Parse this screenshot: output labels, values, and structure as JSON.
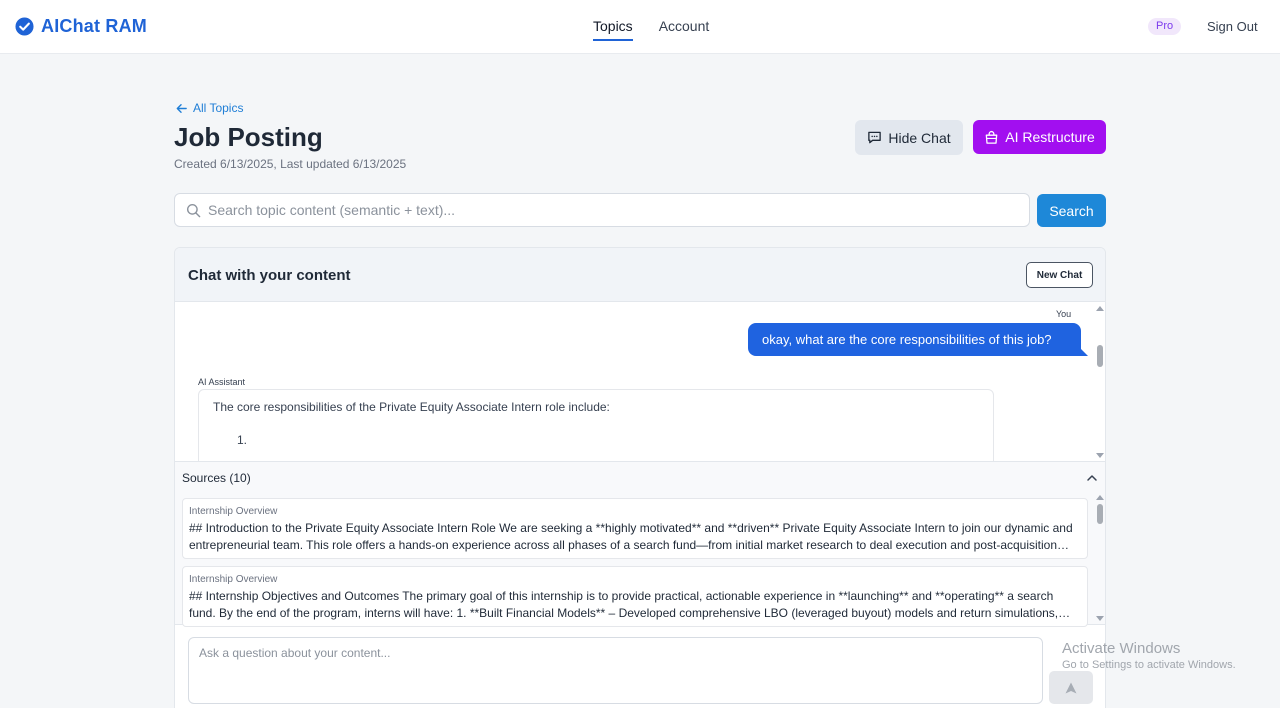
{
  "app": {
    "name": "AIChat RAM"
  },
  "nav": {
    "items": [
      {
        "label": "Topics",
        "active": true
      },
      {
        "label": "Account",
        "active": false
      }
    ],
    "badge": "Pro",
    "signout": "Sign Out"
  },
  "header": {
    "back_label": "All Topics",
    "title": "Job Posting",
    "meta": "Created 6/13/2025, Last updated 6/13/2025",
    "hide_chat_label": "Hide Chat",
    "ai_restructure_label": "AI Restructure"
  },
  "search": {
    "placeholder": "Search topic content (semantic + text)...",
    "value": "",
    "button_label": "Search"
  },
  "chat": {
    "title": "Chat with your content",
    "new_chat_label": "New Chat",
    "messages": [
      {
        "role_label": "You",
        "text": "okay, what are the core responsibilities of this job?"
      },
      {
        "role_label": "AI Assistant",
        "text": "The core responsibilities of the Private Equity Associate Intern role include:",
        "list_marker": "1."
      }
    ],
    "sources": {
      "title": "Sources (10)",
      "items": [
        {
          "heading": "Internship Overview",
          "body": "## Introduction to the Private Equity Associate Intern Role We are seeking a **highly motivated** and **driven** Private Equity Associate Intern to join our dynamic and entrepreneurial team. This role offers a hands-on experience across all phases of a search fund—from initial market research to deal execution and post-acquisition portfolio management."
        },
        {
          "heading": "Internship Overview",
          "body": "## Internship Objectives and Outcomes The primary goal of this internship is to provide practical, actionable experience in **launching** and **operating** a search fund. By the end of the program, interns will have: 1. **Built Financial Models** – Developed comprehensive LBO (leveraged buyout) models and return simulations, projecting cash flows and returns."
        }
      ]
    },
    "input_placeholder": "Ask a question about your content...",
    "input_value": ""
  },
  "watermark": {
    "title": "Activate Windows",
    "subtitle": "Go to Settings to activate Windows."
  },
  "colors": {
    "brand": "#1f63d6",
    "ai_button": "#a20ff0",
    "search_button": "#1e88d8",
    "user_bubble": "#1f63e0",
    "pro_badge_bg": "#f1e7fb"
  },
  "icons": {
    "brand": "check-circle-icon",
    "back": "arrow-left-icon",
    "hide_chat": "message-square-icon",
    "ai_restructure": "shopping-bag-icon",
    "search": "search-icon",
    "sources_toggle": "chevron-up-icon",
    "send": "send-arrow-icon"
  }
}
